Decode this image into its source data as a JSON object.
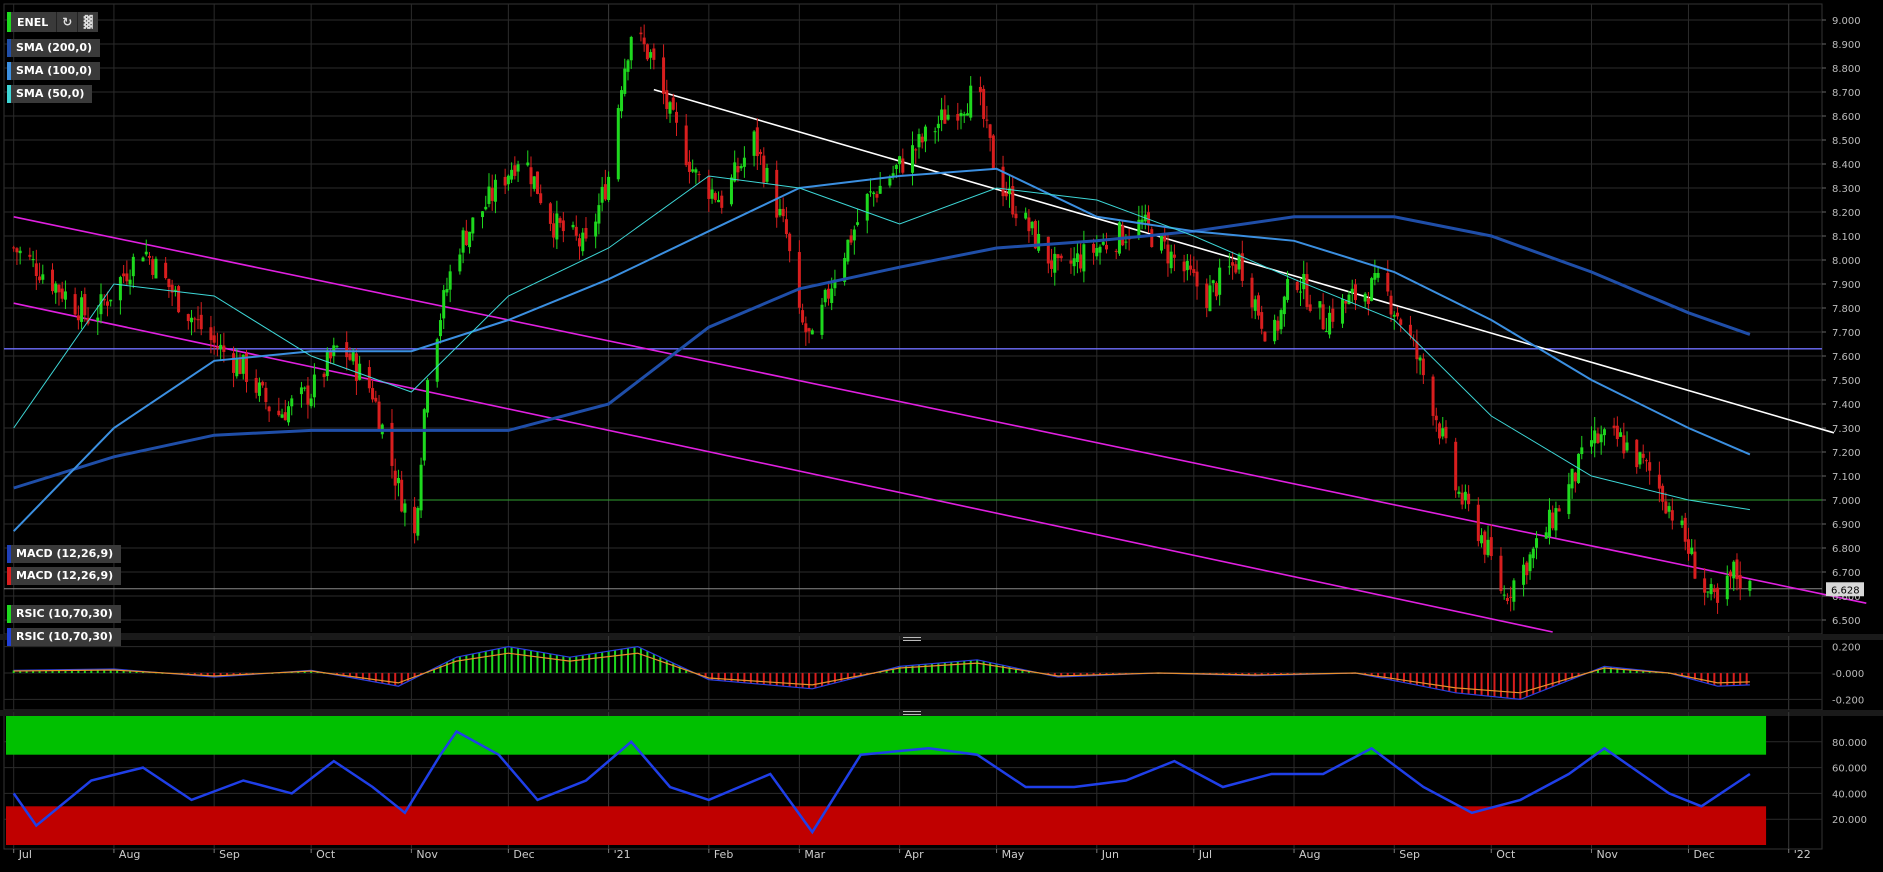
{
  "symbol": "ENEL",
  "toolbar": {
    "refresh_icon": "refresh-icon",
    "chart_settings_icon": "bar-chart-icon"
  },
  "overlays": [
    {
      "label": "SMA (200,0)",
      "color": "#1f4ea8"
    },
    {
      "label": "SMA (100,0)",
      "color": "#3b8fe0"
    },
    {
      "label": "SMA (50,0)",
      "color": "#3dd6d6"
    }
  ],
  "last_price_label": "6.628",
  "colors": {
    "up": "#1ed81e",
    "down": "#d81e1e",
    "grid": "#2b2b2b",
    "background": "#000000",
    "channel": "#e020e0",
    "trend": "#ffffff",
    "level_line": "#6f6fff"
  },
  "x_ticks": [
    "Jul",
    "Aug",
    "Sep",
    "Oct",
    "Nov",
    "Dec",
    "'21",
    "Feb",
    "Mar",
    "Apr",
    "May",
    "Jun",
    "Jul",
    "Aug",
    "Sep",
    "Oct",
    "Nov",
    "Dec",
    "'22"
  ],
  "macd_panel": {
    "labels": [
      "MACD (12,26,9)",
      "MACD (12,26,9)"
    ],
    "ticks": [
      "0.200",
      "-0.000",
      "-0.200"
    ]
  },
  "rsi_panel": {
    "labels": [
      "RSIC (10,70,30)",
      "RSIC (10,70,30)"
    ],
    "ticks": [
      "80.000",
      "60.000",
      "40.000",
      "20.000"
    ]
  },
  "chart_data": {
    "type": "candlestick",
    "price_ticks": [
      "9.000",
      "8.900",
      "8.800",
      "8.700",
      "8.600",
      "8.500",
      "8.400",
      "8.300",
      "8.200",
      "8.100",
      "8.000",
      "7.900",
      "7.800",
      "7.700",
      "7.600",
      "7.500",
      "7.400",
      "7.300",
      "7.200",
      "7.100",
      "7.000",
      "6.900",
      "6.800",
      "6.700",
      "6.600",
      "6.500"
    ],
    "ylim": [
      6.45,
      9.05
    ],
    "horizontal_levels": [
      7.63,
      7.0,
      6.63
    ],
    "price_path": [
      [
        "2020-07-01",
        8.05
      ],
      [
        "2020-07-10",
        7.95
      ],
      [
        "2020-07-25",
        7.75
      ],
      [
        "2020-08-10",
        8.05
      ],
      [
        "2020-08-20",
        7.85
      ],
      [
        "2020-09-01",
        7.65
      ],
      [
        "2020-09-10",
        7.55
      ],
      [
        "2020-09-20",
        7.35
      ],
      [
        "2020-10-01",
        7.45
      ],
      [
        "2020-10-10",
        7.65
      ],
      [
        "2020-10-20",
        7.45
      ],
      [
        "2020-10-28",
        7.05
      ],
      [
        "2020-11-02",
        6.85
      ],
      [
        "2020-11-06",
        7.55
      ],
      [
        "2020-11-15",
        8.05
      ],
      [
        "2020-11-25",
        8.25
      ],
      [
        "2020-12-05",
        8.45
      ],
      [
        "2020-12-15",
        8.15
      ],
      [
        "2020-12-25",
        8.05
      ],
      [
        "2021-01-01",
        8.35
      ],
      [
        "2021-01-05",
        8.75
      ],
      [
        "2021-01-08",
        8.95
      ],
      [
        "2021-01-14",
        8.85
      ],
      [
        "2021-01-20",
        8.6
      ],
      [
        "2021-01-28",
        8.35
      ],
      [
        "2021-02-05",
        8.25
      ],
      [
        "2021-02-15",
        8.5
      ],
      [
        "2021-02-25",
        8.1
      ],
      [
        "2021-03-01",
        7.75
      ],
      [
        "2021-03-05",
        7.65
      ],
      [
        "2021-03-12",
        7.95
      ],
      [
        "2021-03-22",
        8.25
      ],
      [
        "2021-04-05",
        8.45
      ],
      [
        "2021-04-15",
        8.6
      ],
      [
        "2021-04-25",
        8.7
      ],
      [
        "2021-05-01",
        8.35
      ],
      [
        "2021-05-10",
        8.15
      ],
      [
        "2021-05-20",
        7.95
      ],
      [
        "2021-06-01",
        8.05
      ],
      [
        "2021-06-15",
        8.15
      ],
      [
        "2021-06-25",
        8.0
      ],
      [
        "2021-07-05",
        7.85
      ],
      [
        "2021-07-15",
        8.0
      ],
      [
        "2021-07-25",
        7.65
      ],
      [
        "2021-08-01",
        7.95
      ],
      [
        "2021-08-10",
        7.75
      ],
      [
        "2021-08-20",
        7.85
      ],
      [
        "2021-08-28",
        7.9
      ],
      [
        "2021-09-05",
        7.7
      ],
      [
        "2021-09-12",
        7.45
      ],
      [
        "2021-09-20",
        7.05
      ],
      [
        "2021-09-28",
        6.85
      ],
      [
        "2021-10-05",
        6.6
      ],
      [
        "2021-10-15",
        6.8
      ],
      [
        "2021-10-25",
        7.05
      ],
      [
        "2021-11-01",
        7.25
      ],
      [
        "2021-11-10",
        7.25
      ],
      [
        "2021-11-20",
        7.1
      ],
      [
        "2021-11-28",
        6.9
      ],
      [
        "2021-12-05",
        6.65
      ],
      [
        "2021-12-10",
        6.55
      ],
      [
        "2021-12-15",
        6.7
      ],
      [
        "2021-12-20",
        6.63
      ]
    ],
    "sma_50": [
      [
        "2020-07-01",
        7.3
      ],
      [
        "2020-08-01",
        7.9
      ],
      [
        "2020-09-01",
        7.85
      ],
      [
        "2020-10-01",
        7.6
      ],
      [
        "2020-11-01",
        7.45
      ],
      [
        "2020-12-01",
        7.85
      ],
      [
        "2021-01-01",
        8.05
      ],
      [
        "2021-02-01",
        8.35
      ],
      [
        "2021-03-01",
        8.3
      ],
      [
        "2021-04-01",
        8.15
      ],
      [
        "2021-05-01",
        8.3
      ],
      [
        "2021-06-01",
        8.25
      ],
      [
        "2021-07-01",
        8.1
      ],
      [
        "2021-08-01",
        7.92
      ],
      [
        "2021-09-01",
        7.75
      ],
      [
        "2021-10-01",
        7.35
      ],
      [
        "2021-11-01",
        7.1
      ],
      [
        "2021-12-01",
        7.0
      ],
      [
        "2021-12-20",
        6.96
      ]
    ],
    "sma_100": [
      [
        "2020-07-01",
        6.87
      ],
      [
        "2020-08-01",
        7.3
      ],
      [
        "2020-09-01",
        7.58
      ],
      [
        "2020-10-01",
        7.62
      ],
      [
        "2020-11-01",
        7.62
      ],
      [
        "2020-12-01",
        7.75
      ],
      [
        "2021-01-01",
        7.92
      ],
      [
        "2021-02-01",
        8.12
      ],
      [
        "2021-03-01",
        8.3
      ],
      [
        "2021-04-01",
        8.35
      ],
      [
        "2021-05-01",
        8.38
      ],
      [
        "2021-06-01",
        8.18
      ],
      [
        "2021-07-01",
        8.12
      ],
      [
        "2021-08-01",
        8.08
      ],
      [
        "2021-09-01",
        7.95
      ],
      [
        "2021-10-01",
        7.75
      ],
      [
        "2021-11-01",
        7.5
      ],
      [
        "2021-12-01",
        7.3
      ],
      [
        "2021-12-20",
        7.19
      ]
    ],
    "sma_200": [
      [
        "2020-07-01",
        7.05
      ],
      [
        "2020-08-01",
        7.18
      ],
      [
        "2020-09-01",
        7.27
      ],
      [
        "2020-10-01",
        7.29
      ],
      [
        "2020-11-01",
        7.29
      ],
      [
        "2020-12-01",
        7.29
      ],
      [
        "2021-01-01",
        7.4
      ],
      [
        "2021-02-01",
        7.72
      ],
      [
        "2021-03-01",
        7.88
      ],
      [
        "2021-04-01",
        7.97
      ],
      [
        "2021-05-01",
        8.05
      ],
      [
        "2021-06-01",
        8.08
      ],
      [
        "2021-07-01",
        8.12
      ],
      [
        "2021-08-01",
        8.18
      ],
      [
        "2021-09-01",
        8.18
      ],
      [
        "2021-10-01",
        8.1
      ],
      [
        "2021-11-01",
        7.95
      ],
      [
        "2021-12-01",
        7.78
      ],
      [
        "2021-12-20",
        7.69
      ]
    ],
    "trendlines": [
      {
        "name": "downtrend",
        "from": [
          "2021-01-15",
          8.71
        ],
        "to": [
          "2022-01-15",
          7.28
        ]
      },
      {
        "name": "channel-upper",
        "from": [
          "2020-07-01",
          8.18
        ],
        "to": [
          "2022-01-25",
          6.57
        ]
      },
      {
        "name": "channel-lower",
        "from": [
          "2020-07-01",
          7.82
        ],
        "to": [
          "2021-10-20",
          6.45
        ]
      }
    ],
    "macd": {
      "ylim": [
        -0.25,
        0.25
      ],
      "values": [
        [
          "2020-07-01",
          0.02
        ],
        [
          "2020-08-01",
          0.03
        ],
        [
          "2020-09-01",
          -0.03
        ],
        [
          "2020-10-01",
          0.02
        ],
        [
          "2020-10-28",
          -0.1
        ],
        [
          "2020-11-15",
          0.12
        ],
        [
          "2020-12-01",
          0.2
        ],
        [
          "2020-12-20",
          0.12
        ],
        [
          "2021-01-10",
          0.2
        ],
        [
          "2021-02-01",
          -0.05
        ],
        [
          "2021-03-05",
          -0.12
        ],
        [
          "2021-04-01",
          0.05
        ],
        [
          "2021-04-25",
          0.1
        ],
        [
          "2021-05-20",
          -0.03
        ],
        [
          "2021-06-20",
          0.0
        ],
        [
          "2021-07-20",
          -0.02
        ],
        [
          "2021-08-20",
          0.0
        ],
        [
          "2021-09-20",
          -0.15
        ],
        [
          "2021-10-10",
          -0.2
        ],
        [
          "2021-11-05",
          0.05
        ],
        [
          "2021-11-25",
          0.0
        ],
        [
          "2021-12-10",
          -0.1
        ],
        [
          "2021-12-20",
          -0.09
        ]
      ]
    },
    "rsi": {
      "ylim": [
        0,
        100
      ],
      "overbought": 70,
      "oversold": 30,
      "values": [
        [
          "2020-07-01",
          40
        ],
        [
          "2020-07-08",
          15
        ],
        [
          "2020-07-25",
          50
        ],
        [
          "2020-08-10",
          60
        ],
        [
          "2020-08-25",
          35
        ],
        [
          "2020-09-10",
          50
        ],
        [
          "2020-09-25",
          40
        ],
        [
          "2020-10-08",
          65
        ],
        [
          "2020-10-20",
          45
        ],
        [
          "2020-10-30",
          25
        ],
        [
          "2020-11-10",
          70
        ],
        [
          "2020-11-15",
          88
        ],
        [
          "2020-11-28",
          70
        ],
        [
          "2020-12-10",
          35
        ],
        [
          "2020-12-25",
          50
        ],
        [
          "2021-01-08",
          80
        ],
        [
          "2021-01-20",
          45
        ],
        [
          "2021-02-01",
          35
        ],
        [
          "2021-02-20",
          55
        ],
        [
          "2021-03-05",
          10
        ],
        [
          "2021-03-20",
          70
        ],
        [
          "2021-04-10",
          75
        ],
        [
          "2021-04-25",
          70
        ],
        [
          "2021-05-10",
          45
        ],
        [
          "2021-05-25",
          45
        ],
        [
          "2021-06-10",
          50
        ],
        [
          "2021-06-25",
          65
        ],
        [
          "2021-07-10",
          45
        ],
        [
          "2021-07-25",
          55
        ],
        [
          "2021-08-10",
          55
        ],
        [
          "2021-08-25",
          75
        ],
        [
          "2021-09-10",
          45
        ],
        [
          "2021-09-25",
          25
        ],
        [
          "2021-10-10",
          35
        ],
        [
          "2021-10-25",
          55
        ],
        [
          "2021-11-05",
          75
        ],
        [
          "2021-11-25",
          40
        ],
        [
          "2021-12-05",
          30
        ],
        [
          "2021-12-20",
          55
        ]
      ]
    }
  }
}
